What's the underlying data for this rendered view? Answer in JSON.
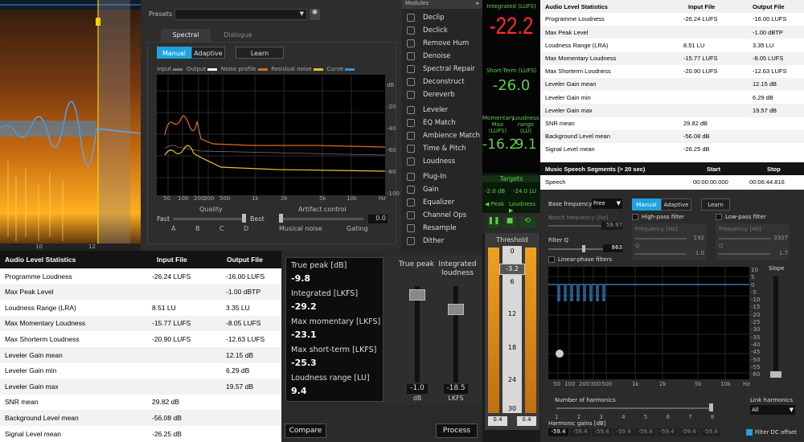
{
  "denoise": {
    "presets_label": "Presets",
    "tabs": [
      "Spectral",
      "Dialogue"
    ],
    "mode_manual": "Manual",
    "mode_adaptive": "Adaptive",
    "learn": "Learn",
    "legend": [
      "Input",
      "Output",
      "Noise profile",
      "Residual noise",
      "Curve"
    ],
    "db_axis": [
      "dB",
      "-20",
      "-40",
      "-60",
      "-80",
      "-100"
    ],
    "freq_axis": [
      "50",
      "100",
      "200",
      "300",
      "500",
      "1k",
      "2k",
      "5k",
      "10k",
      "Hz"
    ],
    "quality_label": "Quality",
    "quality_ticks": [
      "Fast",
      "Best"
    ],
    "quality_letters": [
      "A",
      "B",
      "C",
      "D"
    ],
    "artifact_label": "Artifact control",
    "artifact_value": "0.0",
    "musical_noise": "Musical noise",
    "gating": "Gating"
  },
  "spectrogram": {
    "timeline": [
      "10",
      "12"
    ]
  },
  "modules": {
    "title": "Modules",
    "items": [
      {
        "label": "Declip",
        "icon": "declip-icon"
      },
      {
        "label": "Declick",
        "icon": "declick-icon"
      },
      {
        "label": "Remove Hum",
        "icon": "hum-icon"
      },
      {
        "label": "Denoise",
        "icon": "denoise-icon"
      },
      {
        "label": "Spectral Repair",
        "icon": "spectral-repair-icon"
      },
      {
        "label": "Deconstruct",
        "icon": "deconstruct-icon"
      },
      {
        "label": "Dereverb",
        "icon": "dereverb-icon"
      },
      {
        "label": "Leveler",
        "icon": "leveler-icon"
      },
      {
        "label": "EQ Match",
        "icon": "eq-match-icon"
      },
      {
        "label": "Ambience Match",
        "icon": "ambience-icon"
      },
      {
        "label": "Time & Pitch",
        "icon": "time-pitch-icon"
      },
      {
        "label": "Loudness",
        "icon": "loudness-icon"
      },
      {
        "label": "Plug-In",
        "icon": "plugin-icon"
      },
      {
        "label": "Gain",
        "icon": "gain-icon"
      },
      {
        "label": "Equalizer",
        "icon": "equalizer-icon"
      },
      {
        "label": "Channel Ops",
        "icon": "channel-ops-icon"
      },
      {
        "label": "Resample",
        "icon": "resample-icon"
      },
      {
        "label": "Dither",
        "icon": "dither-icon"
      }
    ]
  },
  "loudness_meter": {
    "integrated_label": "Integrated (LUFS)",
    "integrated_value": "-22.2",
    "short_term_label": "Short-Term (LUFS)",
    "short_term_value": "-26.0",
    "momentary_label": "Momentary Max (LUFS)",
    "momentary_value": "-16.2",
    "range_label": "Loudness range (LU)",
    "range_value": "9.1",
    "targets_label": "Targets",
    "target_a": "-2.0",
    "target_a_unit": "dB",
    "target_b": "-24.0",
    "target_b_unit": "LU",
    "peak_label": "Peak",
    "loudness_label": "Loudness"
  },
  "threshold": {
    "title": "Threshold",
    "scale": [
      "0",
      "6",
      "12",
      "18",
      "24",
      "30"
    ],
    "value": "-3.2",
    "min_left": "0.4",
    "min_right": "0.4"
  },
  "stats": {
    "title": "Audio Level Statistics",
    "col_in": "Input File",
    "col_out": "Output File",
    "rows": [
      {
        "label": "Programme Loudness",
        "in": "-26.24 LUFS",
        "out": "-16.00 LUFS"
      },
      {
        "label": "Max Peak Level",
        "in": "",
        "out": "-1.00 dBTP"
      },
      {
        "label": "Loudness Range (LRA)",
        "in": "8.51 LU",
        "out": "3.35 LU"
      },
      {
        "label": "Max Momentary Loudness",
        "in": "-15.77 LUFS",
        "out": "-8.05 LUFS"
      },
      {
        "label": "Max Shorterm Loudness",
        "in": "-20.90 LUFS",
        "out": "-12.63 LUFS"
      },
      {
        "label": "Leveler Gain mean",
        "in": "",
        "out": "12.15 dB"
      },
      {
        "label": "Leveler Gain min",
        "in": "",
        "out": "6.29 dB"
      },
      {
        "label": "Leveler Gain max",
        "in": "",
        "out": "19.57 dB"
      },
      {
        "label": "SNR mean",
        "in": "29.82 dB",
        "out": ""
      },
      {
        "label": "Background Level mean",
        "in": "-56.08 dB",
        "out": ""
      },
      {
        "label": "Signal Level mean",
        "in": "-26.25 dB",
        "out": ""
      }
    ]
  },
  "segments": {
    "title": "Music Speech Segments (> 20 sec)",
    "col_start": "Start",
    "col_stop": "Stop",
    "row": {
      "label": "Speech",
      "start": "00:00:00.000",
      "stop": "00:06:44.816"
    }
  },
  "level_stats": {
    "rows": [
      {
        "label": "True peak [dB]",
        "value": "-9.8"
      },
      {
        "label": "Integrated [LKFS]",
        "value": "-29.2"
      },
      {
        "label": "Max momentary [LKFS]",
        "value": "-23.1"
      },
      {
        "label": "Max short-term [LKFS]",
        "value": "-25.3"
      },
      {
        "label": "Loudness range [LU]",
        "value": "9.4"
      }
    ],
    "fader1_label": "True peak",
    "fader1_value": "-1.0",
    "fader1_unit": "dB",
    "fader2_label": "Integrated loudness",
    "fader2_value": "-18.5",
    "fader2_unit": "LKFS",
    "compare": "Compare",
    "process": "Process"
  },
  "eq": {
    "base_freq_label": "Base frequency",
    "base_freq_value": "Free",
    "manual": "Manual",
    "adaptive": "Adaptive",
    "learn": "Learn",
    "notch_label": "Notch frequency [Hz]",
    "notch_value": "59.97",
    "filter_q_label": "Filter Q",
    "filter_q_value": "863",
    "linear_phase": "Linear-phase filters",
    "highpass": "High-pass filter",
    "lowpass": "Low-pass filter",
    "freq_label": "Frequency [Hz]",
    "hp_freq": "192",
    "lp_freq": "3307",
    "q_label": "Q",
    "hp_q": "1.0",
    "lp_q": "1.7",
    "slope": "Slope",
    "db_axis": [
      "10",
      "5",
      "0",
      "-5",
      "-10",
      "-15",
      "-20",
      "-25",
      "-30",
      "-35",
      "-40",
      "-45",
      "-50",
      "-55",
      "-60"
    ],
    "freq_axis": [
      "50",
      "100",
      "200",
      "300",
      "500",
      "1k",
      "2k",
      "5k",
      "10k",
      "Hz"
    ],
    "harmonics_label": "Number of harmonics",
    "harmonics_ticks": [
      "1",
      "2",
      "3",
      "4",
      "5",
      "6",
      "7",
      "8"
    ],
    "link_label": "Link harmonics",
    "link_value": "All",
    "gains_label": "Harmonic gains [dB]",
    "gains": [
      "-59.4",
      "-59.4",
      "-59.4",
      "-59.4",
      "-59.4",
      "-59.4",
      "-59.4",
      "-59.4"
    ],
    "dc_offset": "Filter DC offset"
  }
}
